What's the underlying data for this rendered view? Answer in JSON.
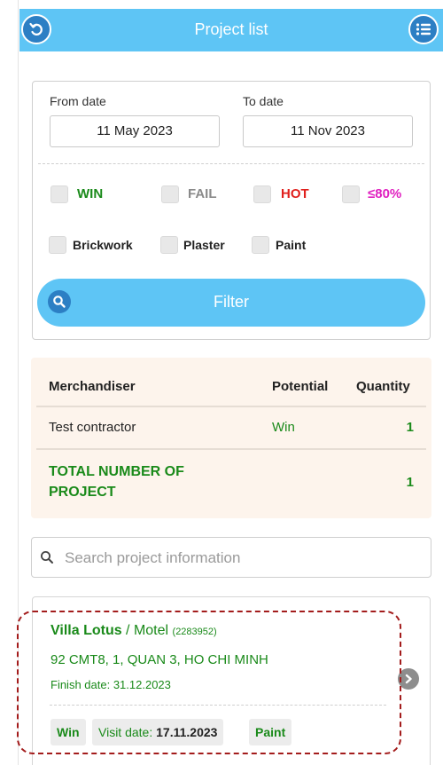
{
  "header": {
    "title": "Project list"
  },
  "filter": {
    "from_label": "From date",
    "from_value": "11 May 2023",
    "to_label": "To date",
    "to_value": "11 Nov 2023",
    "status_options": [
      {
        "label": "WIN",
        "color": "#1a8a1a"
      },
      {
        "label": "FAIL",
        "color": "#8a8a8a"
      },
      {
        "label": "HOT",
        "color": "#e0201c"
      },
      {
        "label": "≤80%",
        "color": "#e020c0"
      }
    ],
    "type_options": [
      {
        "label": "Brickwork"
      },
      {
        "label": "Plaster"
      },
      {
        "label": "Paint"
      }
    ],
    "filter_button": "Filter"
  },
  "summary": {
    "headers": {
      "merchandiser": "Merchandiser",
      "potential": "Potential",
      "quantity": "Quantity"
    },
    "rows": [
      {
        "merchandiser": "Test contractor",
        "potential": "Win",
        "quantity": "1"
      }
    ],
    "total": {
      "label_line1": "TOTAL NUMBER OF",
      "label_line2": "PROJECT",
      "quantity": "1"
    }
  },
  "search": {
    "placeholder": "Search project information"
  },
  "projects": [
    {
      "name": "Villa Lotus",
      "separator": " / ",
      "type": "Motel",
      "code": "(2283952)",
      "address": "92 CMT8, 1, QUAN 3, HO CHI MINH",
      "finish_date": "Finish date: 31.12.2023",
      "status_chip": "Win",
      "visit_label": "Visit date: ",
      "visit_date": "17.11.2023",
      "category_chip": "Paint"
    }
  ],
  "colors": {
    "accent": "#5ec5f5",
    "accent_dark": "#2c7fc4",
    "green": "#1a8a1a",
    "highlight": "#a31c1c"
  }
}
